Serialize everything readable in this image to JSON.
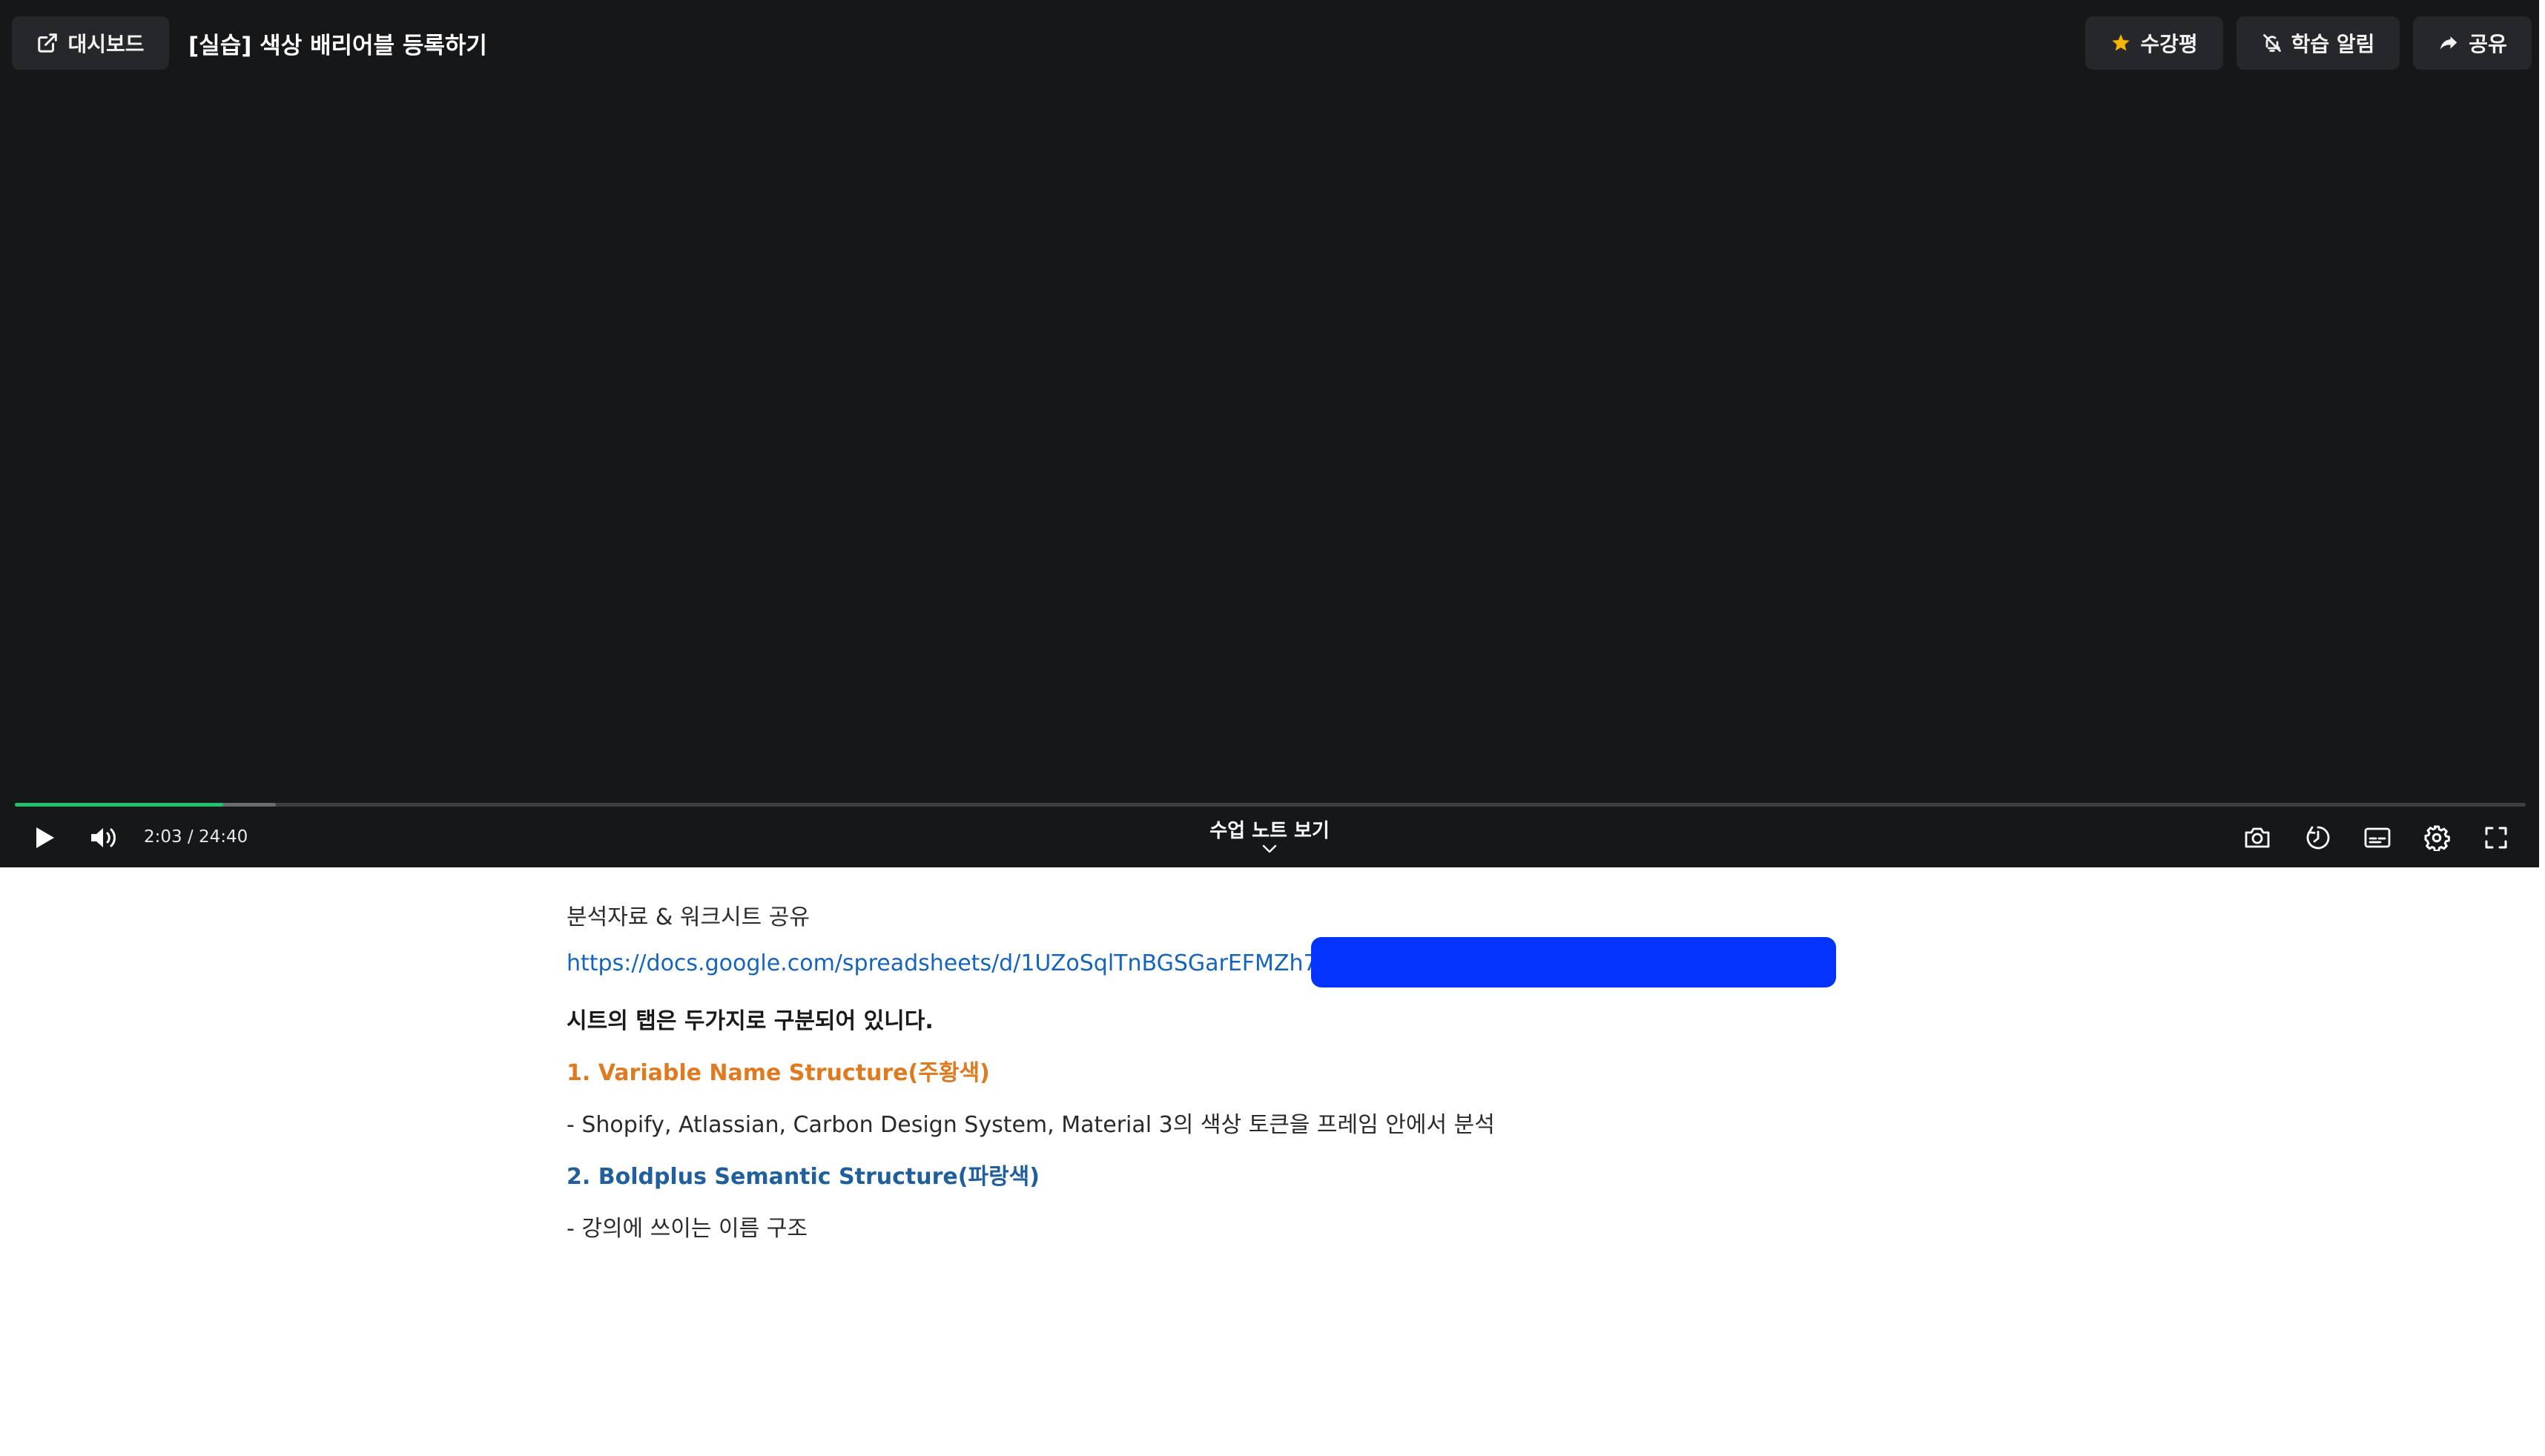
{
  "header": {
    "dashboard_label": "대시보드",
    "lesson_title": "[실습] 색상 배리어블 등록하기",
    "review_label": "수강평",
    "alarm_label": "학습 알림",
    "share_label": "공유"
  },
  "player": {
    "current_time": "2:03",
    "duration": "24:40",
    "time_display": "2:03 / 24:40",
    "progress_fraction": 0.083,
    "buffered_fraction": 0.104,
    "note_toggle_label": "수업 노트 보기"
  },
  "colors": {
    "player_bg": "#161719",
    "button_bg": "#26272b",
    "progress": "#1fc16b",
    "link": "#1565c0",
    "orange_heading": "#e07a1f",
    "blue_heading": "#1f5f9e",
    "redaction": "#0433ff",
    "star": "#f5b400"
  },
  "icons": {
    "dashboard": "external-link-icon",
    "review": "star-icon",
    "alarm": "bell-off-icon",
    "share": "share-arrow-icon",
    "play": "play-icon",
    "volume": "volume-icon",
    "capture": "camera-icon",
    "speed": "playback-speed-icon",
    "subtitles": "subtitles-icon",
    "settings": "gear-icon",
    "fullscreen": "fullscreen-icon",
    "note_chevron": "chevron-down-icon"
  },
  "notes": {
    "intro": "분석자료 & 워크시트 공유",
    "link": "https://docs.google.com/spreadsheets/d/1UZoSqlTnBGSGarEFMZh7F",
    "tabs_intro": "시트의 탭은 두가지로 구분되어 있니다.",
    "item1_heading": "1. Variable Name Structure(주황색)",
    "item1_desc": "- Shopify, Atlassian, Carbon Design System, Material 3의 색상 토큰을 프레임 안에서 분석",
    "item2_heading": "2. Boldplus Semantic Structure(파랑색)",
    "item2_desc": "- 강의에 쓰이는 이름 구조"
  }
}
